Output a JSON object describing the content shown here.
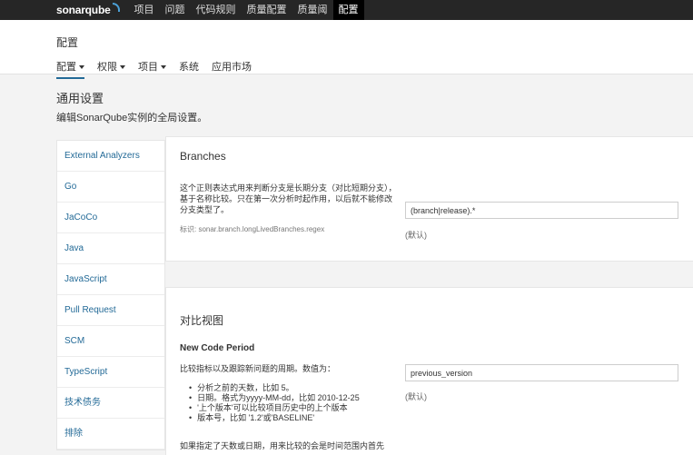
{
  "topbar": {
    "logo": "sonarqube",
    "nav": [
      "项目",
      "问题",
      "代码规则",
      "质量配置",
      "质量阈",
      "配置"
    ],
    "active_index": 5
  },
  "header": {
    "title": "配置",
    "subnav": [
      {
        "label": "配置",
        "dropdown": true,
        "active": true
      },
      {
        "label": "权限",
        "dropdown": true,
        "active": false
      },
      {
        "label": "项目",
        "dropdown": true,
        "active": false
      },
      {
        "label": "系统",
        "dropdown": false,
        "active": false
      },
      {
        "label": "应用市场",
        "dropdown": false,
        "active": false
      }
    ]
  },
  "section": {
    "title": "通用设置",
    "description": "编辑SonarQube实例的全局设置。"
  },
  "categories": [
    "External Analyzers",
    "Go",
    "JaCoCo",
    "Java",
    "JavaScript",
    "Pull Request",
    "SCM",
    "TypeScript",
    "技术债务",
    "排除"
  ],
  "branches": {
    "title": "Branches",
    "description": "这个正则表达式用来判断分支是长期分支（对比短期分支），基于名称比较。只在第一次分析时起作用，以后就不能修改分支类型了。",
    "key": "标识: sonar.branch.longLivedBranches.regex",
    "value": "(branch|release).*",
    "default_label": "(默认)"
  },
  "compare": {
    "title": "对比视图",
    "field_name": "New Code Period",
    "description": "比较指标以及跟踪新问题的周期。数值为：",
    "bullets": [
      "分析之前的天数，比如 5。",
      "日期。格式为yyyy-MM-dd，比如 2010-12-25",
      "'上个版本'可以比较项目历史中的上个版本",
      "版本号，比如 '1.2'或'BASELINE'"
    ],
    "footer": "如果指定了天数或日期，用来比较的会是时间范围内首先",
    "value": "previous_version",
    "default_label": "(默认)"
  }
}
